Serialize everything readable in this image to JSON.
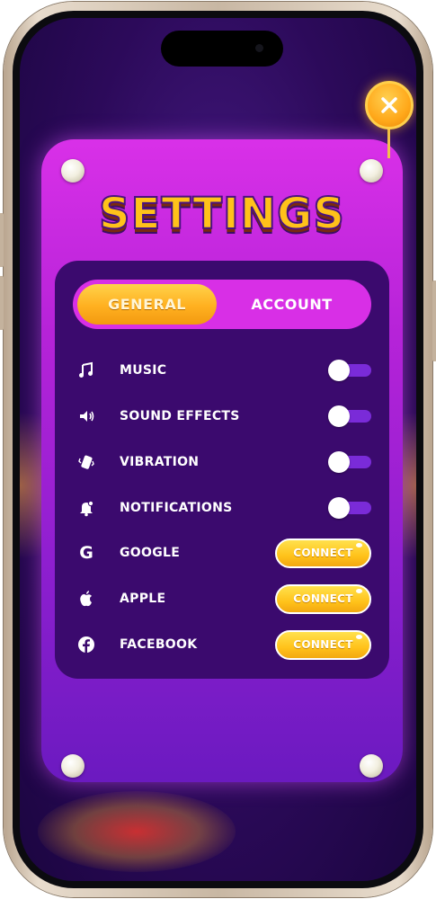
{
  "header": {
    "title": "SETTINGS"
  },
  "tabs": [
    {
      "label": "GENERAL",
      "active": true
    },
    {
      "label": "ACCOUNT",
      "active": false
    }
  ],
  "settings": [
    {
      "label": "MUSIC",
      "icon": "music-note-icon",
      "enabled": false
    },
    {
      "label": "SOUND EFFECTS",
      "icon": "speaker-icon",
      "enabled": false
    },
    {
      "label": "VIBRATION",
      "icon": "vibration-icon",
      "enabled": false
    },
    {
      "label": "NOTIFICATIONS",
      "icon": "bell-icon",
      "enabled": false
    }
  ],
  "accounts": [
    {
      "label": "GOOGLE",
      "icon": "google-icon",
      "button": "CONNECT"
    },
    {
      "label": "APPLE",
      "icon": "apple-icon",
      "button": "CONNECT"
    },
    {
      "label": "FACEBOOK",
      "icon": "facebook-icon",
      "button": "CONNECT"
    }
  ],
  "colors": {
    "panel": "#b623d8",
    "card": "#3b0a6e",
    "accent": "#ffc21a",
    "toggle_track": "#7a2bd8"
  }
}
